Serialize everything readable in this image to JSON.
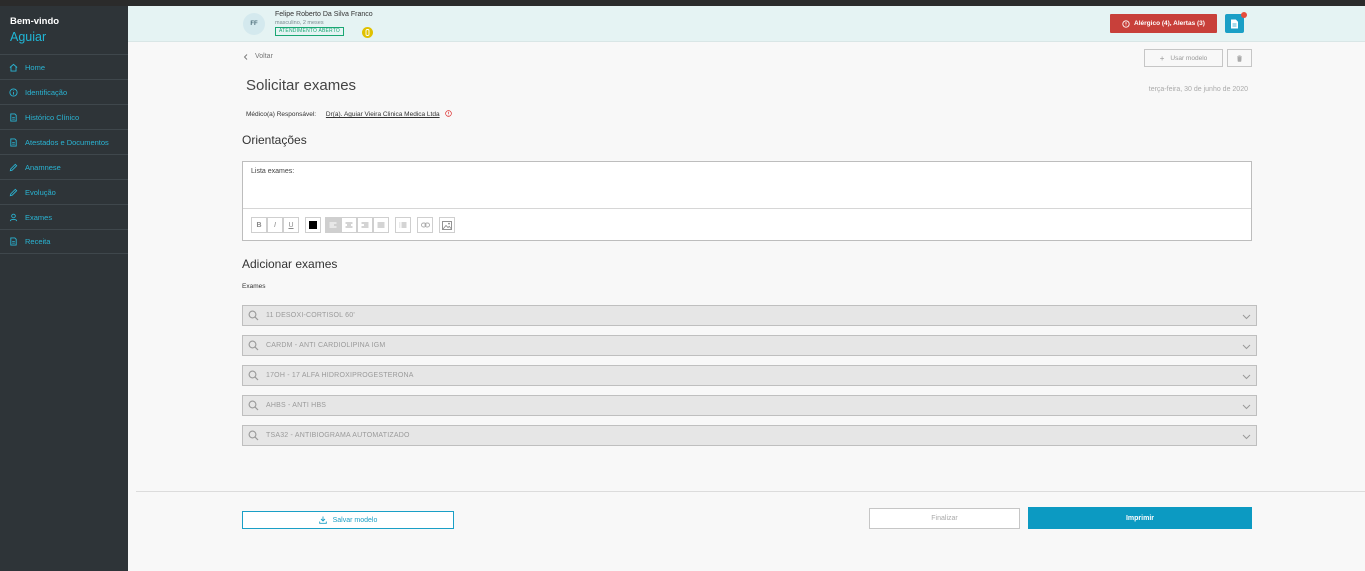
{
  "sidebar": {
    "welcome": "Bem-vindo",
    "user": "Aguiar",
    "items": [
      {
        "label": "Home",
        "icon": "home-icon"
      },
      {
        "label": "Identificação",
        "icon": "info-icon"
      },
      {
        "label": "Histórico Clínico",
        "icon": "document-icon"
      },
      {
        "label": "Atestados e Documentos",
        "icon": "document-icon"
      },
      {
        "label": "Anamnese",
        "icon": "pencil-icon"
      },
      {
        "label": "Evolução",
        "icon": "pencil-icon"
      },
      {
        "label": "Exames",
        "icon": "user-icon"
      },
      {
        "label": "Receita",
        "icon": "document-icon"
      }
    ]
  },
  "patient": {
    "initials": "FF",
    "name": "Felipe Roberto Da Silva Franco",
    "meta": "masculino, 2 meses",
    "status": "ATENDIMENTO ABERTO"
  },
  "header": {
    "alerts_label": "Alérgico (4),  Alertas (3)"
  },
  "page": {
    "back_label": "Voltar",
    "use_model_label": "Usar modelo",
    "title": "Solicitar exames",
    "date": "terça-feira, 30 de junho de 2020",
    "responsible_label": "Médico(a) Responsável:",
    "responsible_name": "Dr(a). Aguiar Vieira Clinica Medica Ltda"
  },
  "orientacoes": {
    "title": "Orientações",
    "editor_text": "Lista exames:",
    "toolbar": [
      "B",
      "I",
      "U"
    ]
  },
  "exames": {
    "title": "Adicionar exames",
    "label": "Exames",
    "items": [
      "11 DESOXI-CORTISOL 60'",
      "CARDM - ANTI CARDIOLIPINA IGM",
      "17OH - 17 ALFA HIDROXIPROGESTERONA",
      "AHBS - ANTI HBS",
      "TSA32 - ANTIBIOGRAMA AUTOMATIZADO"
    ]
  },
  "footer": {
    "save_model": "Salvar modelo",
    "finalize": "Finalizar",
    "print": "Imprimir"
  },
  "colors": {
    "sidebar_bg": "#2e3438",
    "accent": "#1a9fc6",
    "alert": "#c8403a",
    "status_green": "#19a773"
  }
}
